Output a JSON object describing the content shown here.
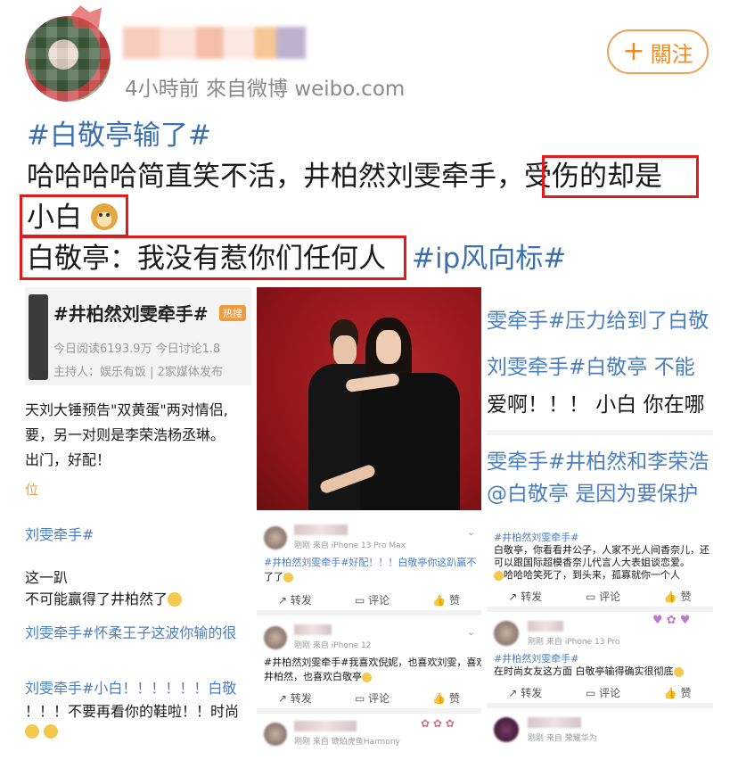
{
  "post": {
    "meta": "4小時前  來自微博 weibo.com",
    "follow_label": "關注",
    "topic1": "#白敬亭输了#",
    "line1": "哈哈哈哈简直笑不活，井柏然刘雯牵手，",
    "line1_boxed": "受伤的却是",
    "line2_boxed": "小白",
    "line3_boxed": "白敬亭：我没有惹你们任何人",
    "topic2": "#ip风向标#"
  },
  "tiles": {
    "left": {
      "topic_title": "#井柏然刘雯牵手#",
      "hot_badge": "热搜",
      "stats": "今日阅读6193.9万  今日讨论1.8",
      "host": "主持人：娱乐有饭 | 2家媒体发布",
      "t1": "天刘大锤预告\"双黄蛋\"两对情侣,",
      "t2": "要，另一对则是李荣浩杨丞琳。",
      "t3": "出门，好配！",
      "t4": "位",
      "t5": "刘雯牵手#",
      "t6": "这一趴",
      "t7": "不可能赢得了井柏然了",
      "t8": "刘雯牵手#怀柔王子这波你输的很",
      "t9": "刘雯牵手#小白！！！！！！白敬",
      "t10": "！！！不要再看你的鞋啦！！时尚"
    },
    "right": {
      "r1": "雯牵手#压力给到了白敬",
      "r2": "刘雯牵手#白敬亭 不能",
      "r3": "爱啊！！！ 小白 你在哪",
      "r4": "雯牵手#井柏然和李荣浩",
      "r5": "@白敬亭  是因为要保护"
    },
    "comments_mid": [
      {
        "source": "刚刚  来自 iPhone 13 Pro Max",
        "text1": "#井柏然刘雯牵手#好配！！！白敬亭你这趴赢不",
        "text2": "了了"
      },
      {
        "source": "刚刚  来自 iPhone 12",
        "text1": "#井柏然刘雯牵手#我喜欢倪妮，也喜欢刘雯，喜欢",
        "text2": "井柏然，也喜欢白敬亭"
      },
      {
        "source": "刚刚  来自 琥珀虎鱼Harmony"
      }
    ],
    "comments_right": [
      {
        "text1": "#井柏然刘雯牵手#",
        "text2": "白敬亭，你看看井公子，人家不光人间香奈儿，还",
        "text3": "可以跟国际超模香奈儿代言人大表姐谈恋爱。",
        "text4": "哈哈哈笑死了，到头来，孤寡就你一个人"
      },
      {
        "source": "刚刚  来自 iPhone 13 Pro",
        "text1": "#井柏然刘雯牵手#",
        "text2": "在时尚女友这方面 白敬亭输得确实很彻底"
      },
      {
        "source": "刚刚  来自 荣耀华为"
      }
    ],
    "actions": {
      "repost": "转发",
      "comment": "评论",
      "like": "赞"
    }
  },
  "colors": {
    "topic": "#3a6fb0",
    "follow": "#f08a20",
    "highlight_box": "#e31b1b"
  }
}
